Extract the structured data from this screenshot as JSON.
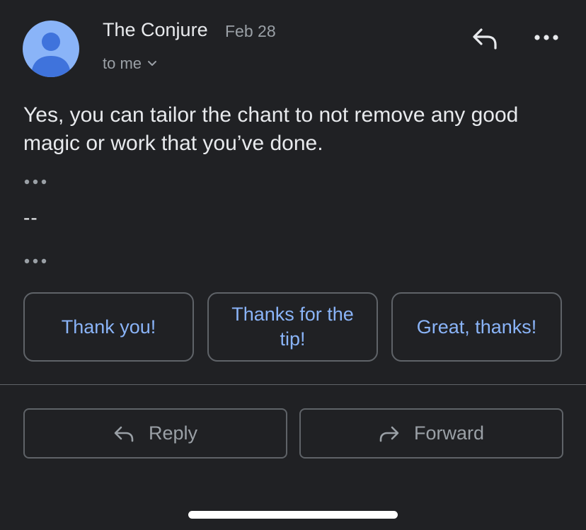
{
  "header": {
    "sender": "The Conjure",
    "date": "Feb 28",
    "recipient": "to me"
  },
  "icons": {
    "avatar": "default-person-avatar",
    "recipient_toggle": "chevron-down-icon",
    "reply": "reply-icon",
    "more": "more-horizontal-icon",
    "forward": "forward-icon"
  },
  "message": {
    "body": "Yes, you can tailor the chant to not remove any good magic or work that you’ve done.",
    "signature_separator": "--"
  },
  "smart_replies": [
    {
      "label": "Thank you!"
    },
    {
      "label": "Thanks for the tip!"
    },
    {
      "label": "Great, thanks!"
    }
  ],
  "actions": {
    "reply_label": "Reply",
    "forward_label": "Forward"
  },
  "colors": {
    "background": "#202124",
    "accent": "#8ab4f8",
    "secondary_text": "#9aa0a6",
    "border": "#5f6368"
  }
}
